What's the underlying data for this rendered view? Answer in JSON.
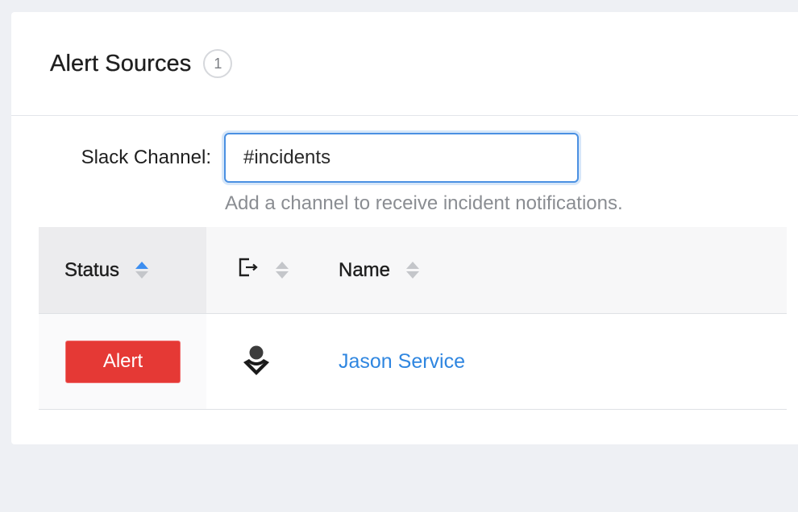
{
  "header": {
    "title": "Alert Sources",
    "count": "1"
  },
  "form": {
    "label": "Slack Channel:",
    "value": "#incidents",
    "help": "Add a channel to receive incident notifications."
  },
  "table": {
    "columns": {
      "status": "Status",
      "name": "Name"
    },
    "rows": [
      {
        "status": "Alert",
        "status_color": "#e53935",
        "source_icon": "bust-person-icon",
        "name": "Jason Service"
      }
    ]
  },
  "colors": {
    "accent": "#3d8ef0",
    "link": "#2f86e0",
    "alert": "#e53935"
  }
}
